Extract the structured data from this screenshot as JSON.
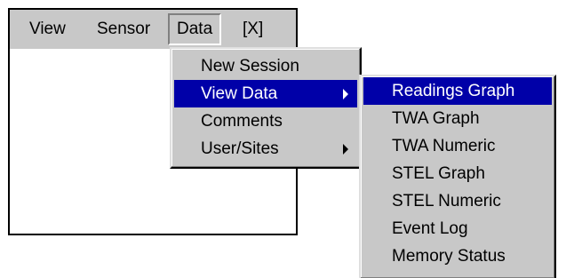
{
  "menubar": {
    "items": [
      {
        "label": "View"
      },
      {
        "label": "Sensor"
      },
      {
        "label": "Data"
      },
      {
        "label": "[X]"
      }
    ]
  },
  "data_menu": {
    "items": [
      {
        "label": "New Session"
      },
      {
        "label": "View Data",
        "highlighted": true,
        "has_submenu": true
      },
      {
        "label": "Comments"
      },
      {
        "label": "User/Sites",
        "has_submenu": true
      }
    ]
  },
  "view_data_submenu": {
    "items": [
      {
        "label": "Readings Graph",
        "highlighted": true
      },
      {
        "label": "TWA Graph"
      },
      {
        "label": "TWA Numeric"
      },
      {
        "label": "STEL Graph"
      },
      {
        "label": "STEL Numeric"
      },
      {
        "label": "Event Log"
      },
      {
        "label": "Memory Status"
      }
    ]
  },
  "colors": {
    "menu_bg": "#c8c8c8",
    "highlight": "#0000a8"
  }
}
